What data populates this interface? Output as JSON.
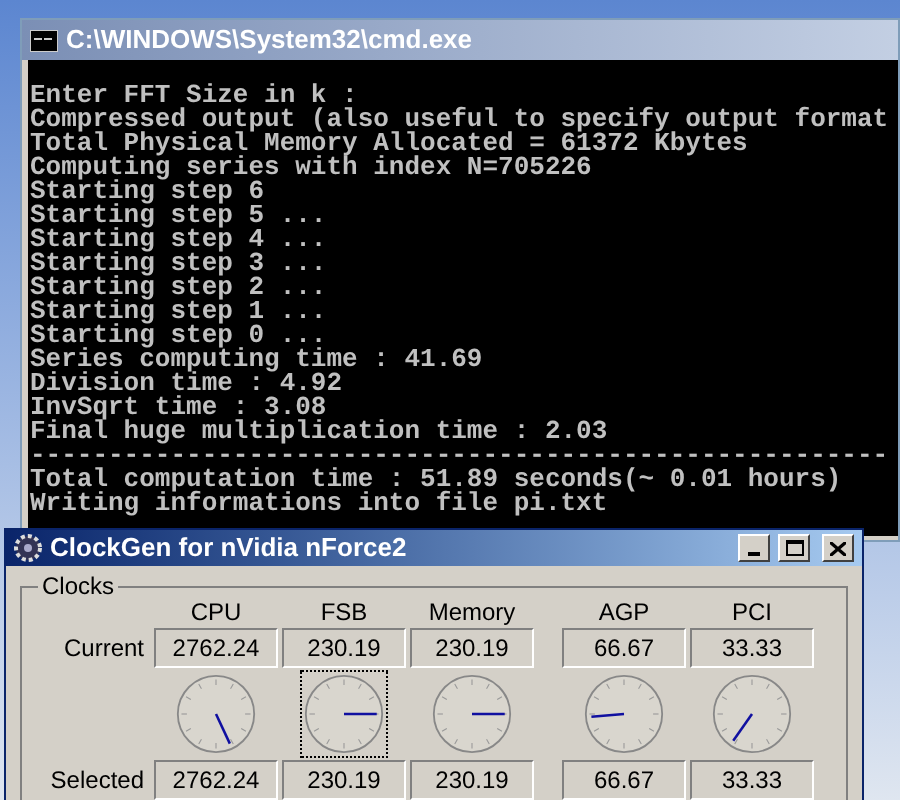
{
  "console_window": {
    "title": "C:\\WINDOWS\\System32\\cmd.exe",
    "output_lines": [
      "Enter FFT Size in k :",
      "Compressed output (also useful to specify output format",
      "Total Physical Memory Allocated = 61372 Kbytes",
      "Computing series with index N=705226",
      "Starting step 6",
      "Starting step 5 ...",
      "Starting step 4 ...",
      "Starting step 3 ...",
      "Starting step 2 ...",
      "Starting step 1 ...",
      "Starting step 0 ...",
      "Series computing time : 41.69",
      "Division time : 4.92",
      "InvSqrt time : 3.08",
      "Final huge multiplication time : 2.03",
      "-------------------------------------------------------",
      "Total computation time : 51.89 seconds(~ 0.01 hours)",
      "Writing informations into file pi.txt"
    ]
  },
  "clockgen_window": {
    "title": "ClockGen for nVidia nForce2",
    "group_label": "Clocks",
    "row_labels": [
      "Current",
      "Selected"
    ],
    "columns": [
      {
        "label": "CPU",
        "current": "2762.24",
        "selected_value": "2762.24",
        "selected": false
      },
      {
        "label": "FSB",
        "current": "230.19",
        "selected_value": "230.19",
        "selected": true
      },
      {
        "label": "Memory",
        "current": "230.19",
        "selected_value": "230.19",
        "selected": false
      },
      {
        "label": "AGP",
        "current": "66.67",
        "selected_value": "66.67",
        "selected": false
      },
      {
        "label": "PCI",
        "current": "33.33",
        "selected_value": "33.33",
        "selected": false
      }
    ]
  }
}
